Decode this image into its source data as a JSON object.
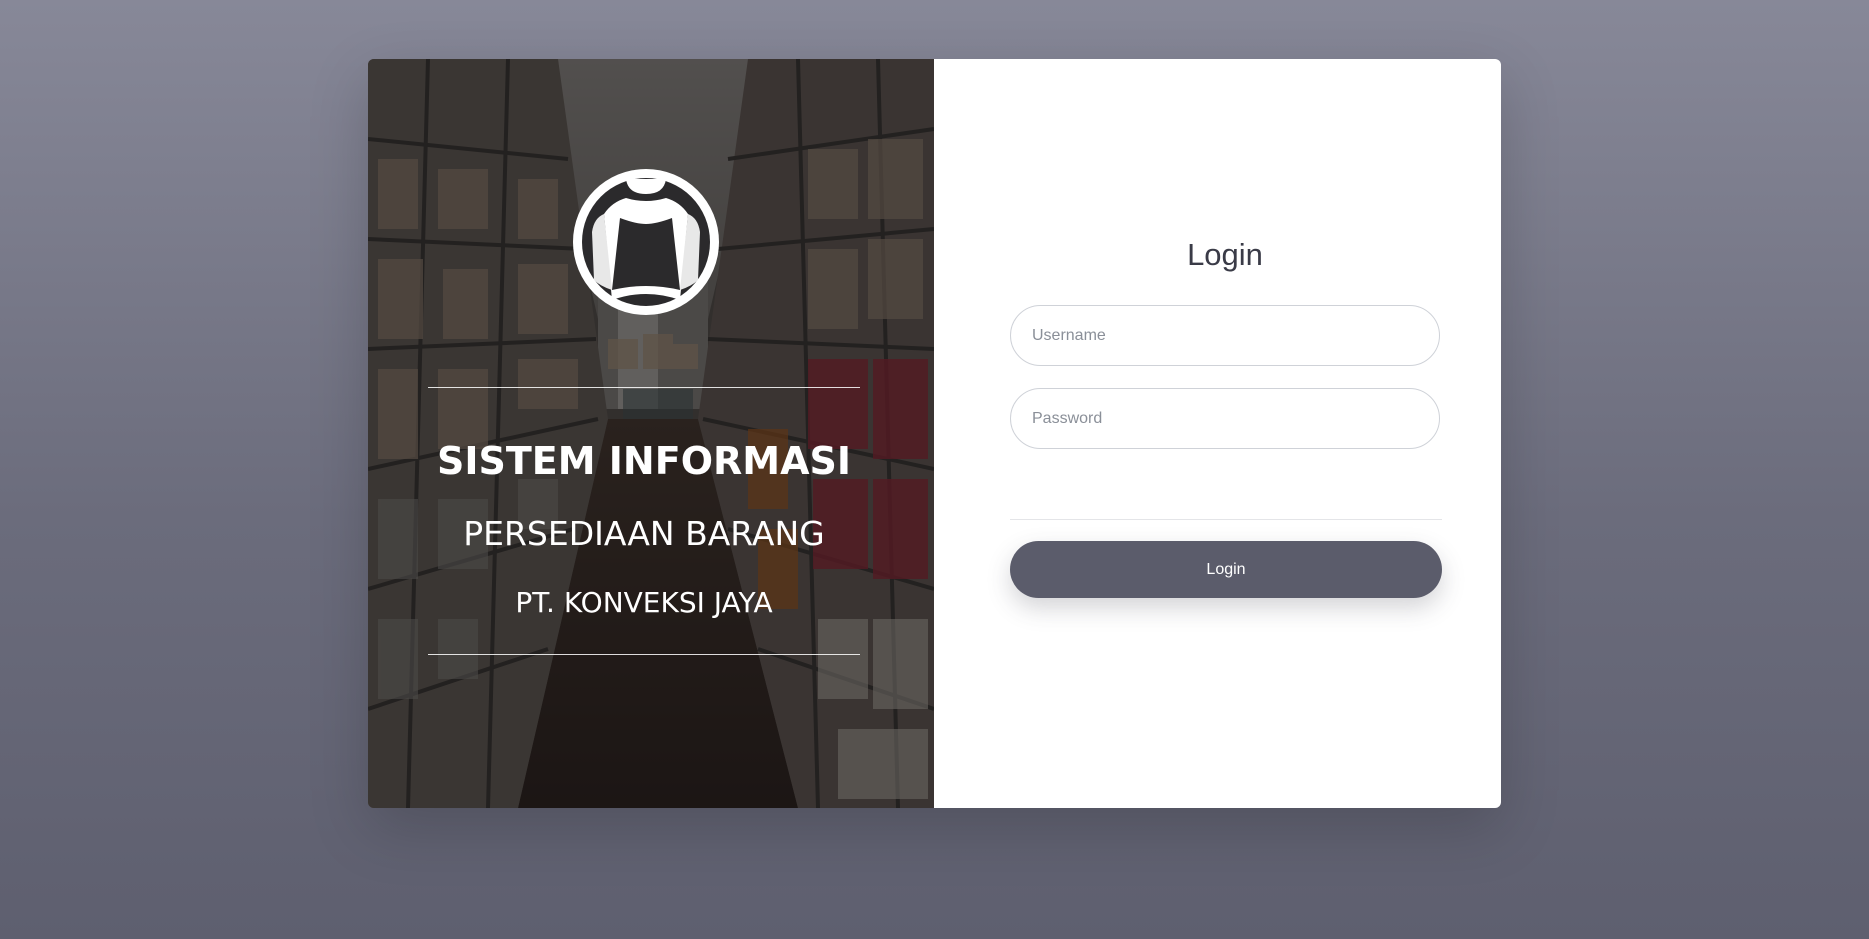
{
  "brand": {
    "line1": "SISTEM INFORMASI",
    "line2": "PERSEDIAAN BARANG",
    "line3": "PT. KONVEKSI JAYA",
    "logo_icon": "tshirt-circle-icon",
    "background_image": "warehouse-shelves-photo"
  },
  "login_form": {
    "title": "Login",
    "username_placeholder": "Username",
    "password_placeholder": "Password",
    "submit_label": "Login"
  },
  "colors": {
    "page_background": "#7a7b8b",
    "button_background": "#5b5c6b",
    "form_background": "#ffffff"
  }
}
